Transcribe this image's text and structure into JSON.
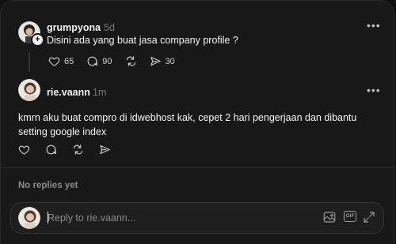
{
  "post": {
    "username": "grumpyona",
    "time": "5d",
    "text": "Disini ada yang buat jasa company profile ?",
    "likes": "65",
    "replies": "90",
    "shares": "30",
    "follow_icon": "plus-icon"
  },
  "reply": {
    "username": "rie.vaann",
    "time": "1m",
    "text": "kmrn aku buat compro di idwebhost kak, cepet 2 hari pengerjaan dan dibantu setting google index"
  },
  "no_replies": "No replies yet",
  "composer": {
    "placeholder": "Reply to rie.vaann...",
    "gif_label": "GIF"
  },
  "icons": [
    "heart-icon",
    "comment-icon",
    "repost-icon",
    "share-icon",
    "more-icon",
    "image-icon",
    "gif-icon",
    "expand-icon"
  ],
  "colors": {
    "background": "#101010",
    "panel": "#181818",
    "text": "#f3f5f7",
    "muted": "#777777"
  }
}
